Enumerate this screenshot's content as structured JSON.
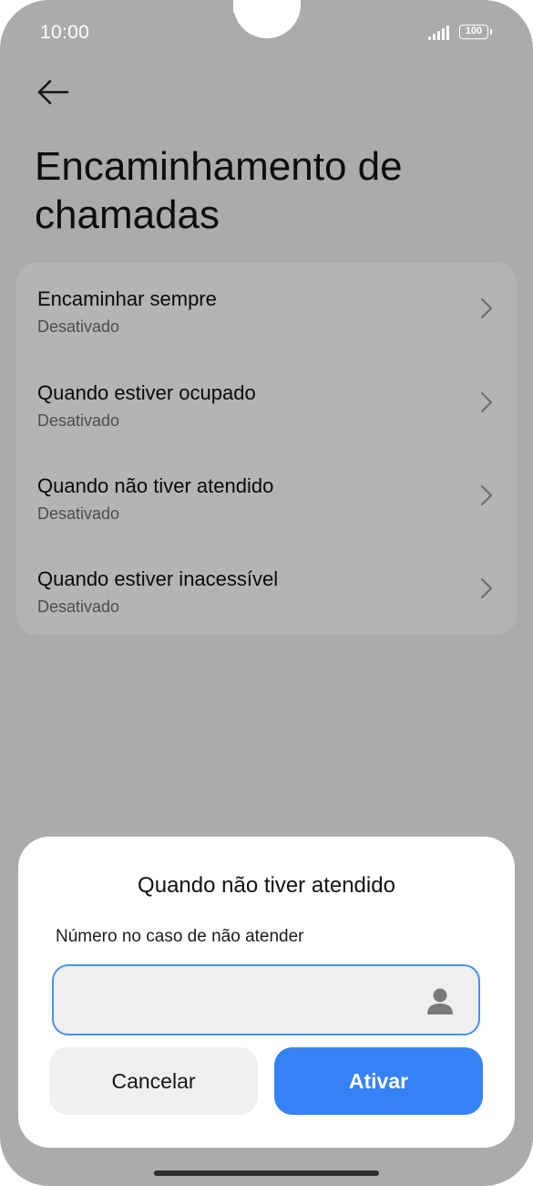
{
  "status_bar": {
    "time": "10:00",
    "battery": "100",
    "signal_icon": "signal-icon"
  },
  "header": {
    "back_icon": "arrow-left-icon",
    "title": "Encaminhamento de chamadas"
  },
  "forwarding_options": [
    {
      "label": "Encaminhar sempre",
      "status": "Desativado"
    },
    {
      "label": "Quando estiver ocupado",
      "status": "Desativado"
    },
    {
      "label": "Quando não tiver atendido",
      "status": "Desativado"
    },
    {
      "label": "Quando estiver inacessível",
      "status": "Desativado"
    }
  ],
  "dialog": {
    "title": "Quando não tiver atendido",
    "field_label": "Número no caso de não atender",
    "input_value": "",
    "contact_icon": "person-icon",
    "cancel_label": "Cancelar",
    "activate_label": "Ativar"
  },
  "colors": {
    "accent": "#3482f6",
    "input_border": "#4a90f0",
    "scrim": "#ababab"
  }
}
